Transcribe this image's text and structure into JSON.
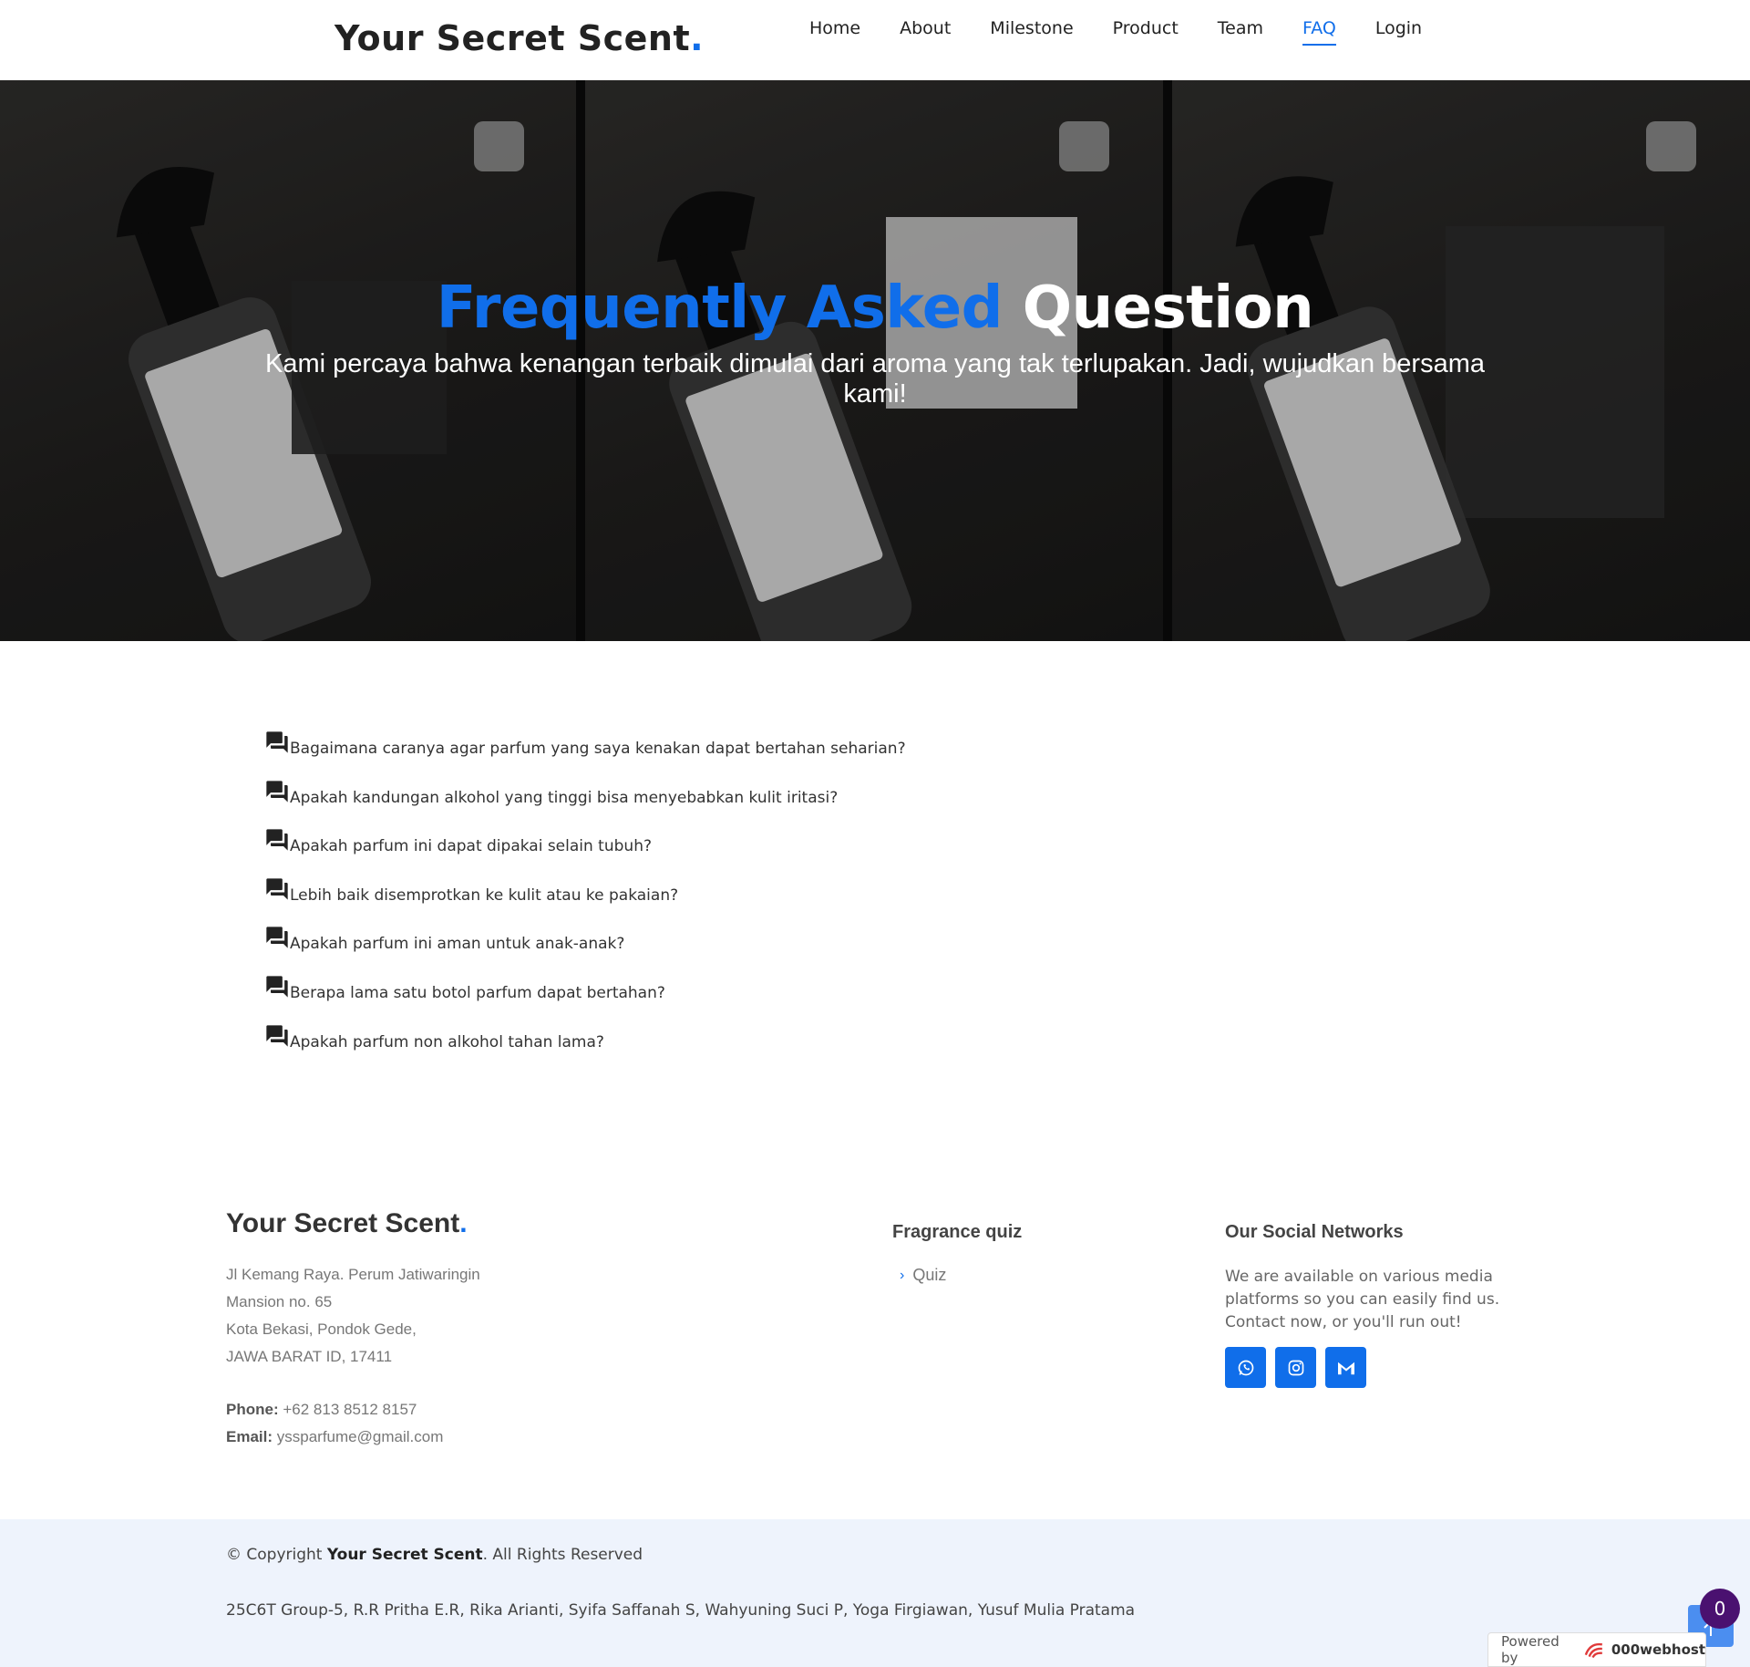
{
  "header": {
    "logo_text": "Your Secret Scent",
    "logo_dot": ".",
    "nav": [
      {
        "label": "Home"
      },
      {
        "label": "About"
      },
      {
        "label": "Milestone"
      },
      {
        "label": "Product"
      },
      {
        "label": "Team"
      },
      {
        "label": "FAQ",
        "active": true
      },
      {
        "label": "Login"
      }
    ]
  },
  "hero": {
    "title_blue": "Frequently Asked",
    "title_white": "Question",
    "subtitle": "Kami percaya bahwa kenangan terbaik dimulai dari aroma yang tak terlupakan. Jadi, wujudkan bersama kami!"
  },
  "faq": {
    "questions": [
      " Bagaimana caranya agar parfum yang saya kenakan dapat bertahan seharian?",
      "Apakah kandungan alkohol yang tinggi bisa menyebabkan kulit iritasi?",
      "Apakah parfum ini dapat dipakai selain tubuh?",
      "Lebih baik disemprotkan ke kulit atau ke pakaian?",
      "Apakah parfum ini aman untuk anak-anak?",
      "Berapa lama satu botol parfum dapat bertahan?",
      "Apakah parfum non alkohol tahan lama?"
    ],
    "icon": "question-answer-icon"
  },
  "footer": {
    "logo_text": "Your Secret Scent",
    "logo_dot": ".",
    "address": [
      "Jl Kemang Raya. Perum Jatiwaringin",
      "Mansion no. 65",
      "Kota Bekasi, Pondok Gede,",
      "JAWA BARAT ID, 17411"
    ],
    "phone_label": "Phone:",
    "phone": "+62 813 8512 8157",
    "email_label": "Email:",
    "email": "yssparfume@gmail.com",
    "quiz_heading": "Fragrance quiz",
    "quiz_link": "Quiz",
    "social_heading": "Our Social Networks",
    "social_text": "We are available on various media platforms so you can easily find us. Contact now, or you'll run out!",
    "social_icons": [
      "whatsapp-icon",
      "instagram-icon",
      "gmail-icon"
    ]
  },
  "bottom": {
    "copyright_prefix": "© Copyright",
    "copyright_brand": "Your Secret Scent",
    "copyright_suffix": ". All Rights Reserved",
    "credits": "25C6T Group-5, R.R Pritha E.R, Rika Arianti, Syifa Saffanah S, Wahyuning Suci P, Yoga Firgiawan, Yusuf Mulia Pratama"
  },
  "widgets": {
    "notification_count": "0",
    "powered_by": "Powered by",
    "host_brand": "000webhost"
  },
  "colors": {
    "accent": "#106eea",
    "bottom_bg": "#eef3fc",
    "badge": "#4a1170"
  }
}
